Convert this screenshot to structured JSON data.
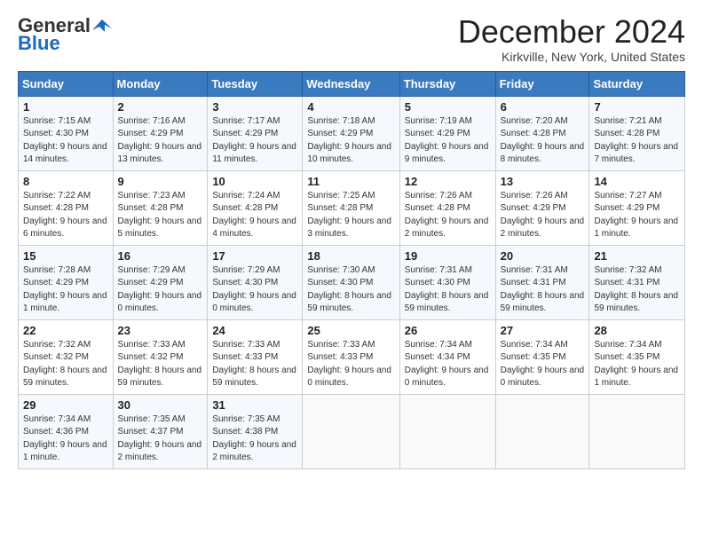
{
  "header": {
    "logo_general": "General",
    "logo_blue": "Blue",
    "month_title": "December 2024",
    "location": "Kirkville, New York, United States"
  },
  "days_of_week": [
    "Sunday",
    "Monday",
    "Tuesday",
    "Wednesday",
    "Thursday",
    "Friday",
    "Saturday"
  ],
  "weeks": [
    [
      {
        "day": "1",
        "sunrise": "7:15 AM",
        "sunset": "4:30 PM",
        "daylight": "9 hours and 14 minutes."
      },
      {
        "day": "2",
        "sunrise": "7:16 AM",
        "sunset": "4:29 PM",
        "daylight": "9 hours and 13 minutes."
      },
      {
        "day": "3",
        "sunrise": "7:17 AM",
        "sunset": "4:29 PM",
        "daylight": "9 hours and 11 minutes."
      },
      {
        "day": "4",
        "sunrise": "7:18 AM",
        "sunset": "4:29 PM",
        "daylight": "9 hours and 10 minutes."
      },
      {
        "day": "5",
        "sunrise": "7:19 AM",
        "sunset": "4:29 PM",
        "daylight": "9 hours and 9 minutes."
      },
      {
        "day": "6",
        "sunrise": "7:20 AM",
        "sunset": "4:28 PM",
        "daylight": "9 hours and 8 minutes."
      },
      {
        "day": "7",
        "sunrise": "7:21 AM",
        "sunset": "4:28 PM",
        "daylight": "9 hours and 7 minutes."
      }
    ],
    [
      {
        "day": "8",
        "sunrise": "7:22 AM",
        "sunset": "4:28 PM",
        "daylight": "9 hours and 6 minutes."
      },
      {
        "day": "9",
        "sunrise": "7:23 AM",
        "sunset": "4:28 PM",
        "daylight": "9 hours and 5 minutes."
      },
      {
        "day": "10",
        "sunrise": "7:24 AM",
        "sunset": "4:28 PM",
        "daylight": "9 hours and 4 minutes."
      },
      {
        "day": "11",
        "sunrise": "7:25 AM",
        "sunset": "4:28 PM",
        "daylight": "9 hours and 3 minutes."
      },
      {
        "day": "12",
        "sunrise": "7:26 AM",
        "sunset": "4:28 PM",
        "daylight": "9 hours and 2 minutes."
      },
      {
        "day": "13",
        "sunrise": "7:26 AM",
        "sunset": "4:29 PM",
        "daylight": "9 hours and 2 minutes."
      },
      {
        "day": "14",
        "sunrise": "7:27 AM",
        "sunset": "4:29 PM",
        "daylight": "9 hours and 1 minute."
      }
    ],
    [
      {
        "day": "15",
        "sunrise": "7:28 AM",
        "sunset": "4:29 PM",
        "daylight": "9 hours and 1 minute."
      },
      {
        "day": "16",
        "sunrise": "7:29 AM",
        "sunset": "4:29 PM",
        "daylight": "9 hours and 0 minutes."
      },
      {
        "day": "17",
        "sunrise": "7:29 AM",
        "sunset": "4:30 PM",
        "daylight": "9 hours and 0 minutes."
      },
      {
        "day": "18",
        "sunrise": "7:30 AM",
        "sunset": "4:30 PM",
        "daylight": "8 hours and 59 minutes."
      },
      {
        "day": "19",
        "sunrise": "7:31 AM",
        "sunset": "4:30 PM",
        "daylight": "8 hours and 59 minutes."
      },
      {
        "day": "20",
        "sunrise": "7:31 AM",
        "sunset": "4:31 PM",
        "daylight": "8 hours and 59 minutes."
      },
      {
        "day": "21",
        "sunrise": "7:32 AM",
        "sunset": "4:31 PM",
        "daylight": "8 hours and 59 minutes."
      }
    ],
    [
      {
        "day": "22",
        "sunrise": "7:32 AM",
        "sunset": "4:32 PM",
        "daylight": "8 hours and 59 minutes."
      },
      {
        "day": "23",
        "sunrise": "7:33 AM",
        "sunset": "4:32 PM",
        "daylight": "8 hours and 59 minutes."
      },
      {
        "day": "24",
        "sunrise": "7:33 AM",
        "sunset": "4:33 PM",
        "daylight": "8 hours and 59 minutes."
      },
      {
        "day": "25",
        "sunrise": "7:33 AM",
        "sunset": "4:33 PM",
        "daylight": "9 hours and 0 minutes."
      },
      {
        "day": "26",
        "sunrise": "7:34 AM",
        "sunset": "4:34 PM",
        "daylight": "9 hours and 0 minutes."
      },
      {
        "day": "27",
        "sunrise": "7:34 AM",
        "sunset": "4:35 PM",
        "daylight": "9 hours and 0 minutes."
      },
      {
        "day": "28",
        "sunrise": "7:34 AM",
        "sunset": "4:35 PM",
        "daylight": "9 hours and 1 minute."
      }
    ],
    [
      {
        "day": "29",
        "sunrise": "7:34 AM",
        "sunset": "4:36 PM",
        "daylight": "9 hours and 1 minute."
      },
      {
        "day": "30",
        "sunrise": "7:35 AM",
        "sunset": "4:37 PM",
        "daylight": "9 hours and 2 minutes."
      },
      {
        "day": "31",
        "sunrise": "7:35 AM",
        "sunset": "4:38 PM",
        "daylight": "9 hours and 2 minutes."
      },
      null,
      null,
      null,
      null
    ]
  ]
}
